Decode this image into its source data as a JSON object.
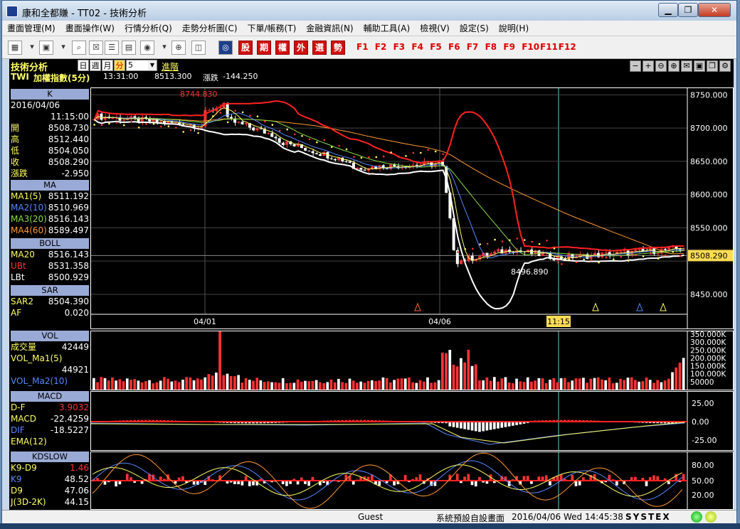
{
  "window": {
    "title": "康和全都賺 - TT02 - 技術分析"
  },
  "menu": [
    "畫面管理(M)",
    "畫面操作(W)",
    "行情分析(Q)",
    "走勢分析圖(C)",
    "下單/帳務(T)",
    "金融資訊(N)",
    "輔助工具(A)",
    "檢視(V)",
    "設定(S)",
    "說明(H)"
  ],
  "toolbar": {
    "red_buttons": [
      "股",
      "期",
      "權",
      "外",
      "選",
      "勢"
    ],
    "fkeys": [
      "F1",
      "F2",
      "F3",
      "F4",
      "F5",
      "F6",
      "F7",
      "F8",
      "F9",
      "F10",
      "F11",
      "F12"
    ]
  },
  "header": {
    "panel_title": "技術分析",
    "periods": [
      "日",
      "週",
      "月",
      "分"
    ],
    "interval": "5",
    "advanced": "進階",
    "symbol": "TWI",
    "name": "加權指數(5分)",
    "time": "13:31:00",
    "price": "8513.300",
    "change_label": "漲跌",
    "change": "-144.250"
  },
  "k": {
    "head": "K",
    "date": "2016/04/06",
    "time": "11:15:00",
    "rows": [
      {
        "l": "開",
        "v": "8508.730"
      },
      {
        "l": "高",
        "v": "8512.440"
      },
      {
        "l": "低",
        "v": "8504.050"
      },
      {
        "l": "收",
        "v": "8508.290"
      },
      {
        "l": "漲跌",
        "v": "-2.950"
      }
    ]
  },
  "ma": {
    "head": "MA",
    "rows": [
      {
        "l": "MA1(5)",
        "v": "8511.192",
        "c": "#ffff66"
      },
      {
        "l": "MA2(10)",
        "v": "8510.969",
        "c": "#5588ff"
      },
      {
        "l": "MA3(20)",
        "v": "8516.143",
        "c": "#88dd44"
      },
      {
        "l": "MA4(60)",
        "v": "8589.497",
        "c": "#ff9933"
      }
    ]
  },
  "boll": {
    "head": "BOLL",
    "rows": [
      {
        "l": "MA20",
        "v": "8516.143",
        "c": "#ffff66"
      },
      {
        "l": "UBt",
        "v": "8531.358",
        "c": "#ff3333"
      },
      {
        "l": "LBt",
        "v": "8500.929",
        "c": "#ffffff"
      }
    ]
  },
  "sar": {
    "head": "SAR",
    "rows": [
      {
        "l": "SAR2",
        "v": "8504.390",
        "c": "#ffff66"
      },
      {
        "l": "AF",
        "v": "0.020",
        "c": "#ffff66"
      }
    ]
  },
  "vol": {
    "head": "VOL",
    "rows": [
      {
        "l": "成交量",
        "v": "42449",
        "c": "#ffff66"
      },
      {
        "l": "VOL_Ma1(5)",
        "v": "",
        "c": "#ffff66"
      },
      {
        "l": "",
        "v": "44921",
        "c": "#ffff66"
      },
      {
        "l": "VOL_Ma2(10)",
        "v": "",
        "c": "#5588ff"
      }
    ]
  },
  "macd": {
    "head": "MACD",
    "rows": [
      {
        "l": "D-F",
        "v": "3.9032",
        "c": "#ffff66",
        "vc": "#ff3333"
      },
      {
        "l": "MACD",
        "v": "-22.4259",
        "c": "#ffff66"
      },
      {
        "l": "DIF",
        "v": "-18.5227",
        "c": "#5588ff"
      },
      {
        "l": "EMA(12)",
        "v": "",
        "c": "#ffff66"
      }
    ]
  },
  "kd": {
    "head": "KDSLOW",
    "rows": [
      {
        "l": "K9-D9",
        "v": "1.46",
        "c": "#ffff66",
        "vc": "#ff3333"
      },
      {
        "l": "K9",
        "v": "48.52",
        "c": "#5588ff"
      },
      {
        "l": "D9",
        "v": "47.06",
        "c": "#ffff66"
      },
      {
        "l": "J(3D-2K)",
        "v": "44.15",
        "c": "#ffff66"
      }
    ]
  },
  "main_axis": [
    "8750.000",
    "8700.000",
    "8650.000",
    "8600.000",
    "8550.000",
    "8508.290",
    "8450.000"
  ],
  "date_labels": [
    "04/01",
    "04/06",
    "11:15"
  ],
  "annotations": {
    "high": "8744.830",
    "low": "8496.890"
  },
  "vol_axis": [
    "350.000K",
    "300.000K",
    "250.000K",
    "200.000K",
    "150.000K",
    "100.000K",
    "50000"
  ],
  "macd_axis": [
    "25.00",
    "0.00",
    "-25.00"
  ],
  "kd_axis": [
    "80.00",
    "50.00",
    "20.00"
  ],
  "status": {
    "user": "Guest",
    "layout": "系統預設自設畫面",
    "datetime": "2016/04/06 Wed 14:45:38",
    "brand": "SYSTEX"
  },
  "chart_data": {
    "type": "line",
    "series": [],
    "ylim": [
      8420,
      8760
    ]
  }
}
